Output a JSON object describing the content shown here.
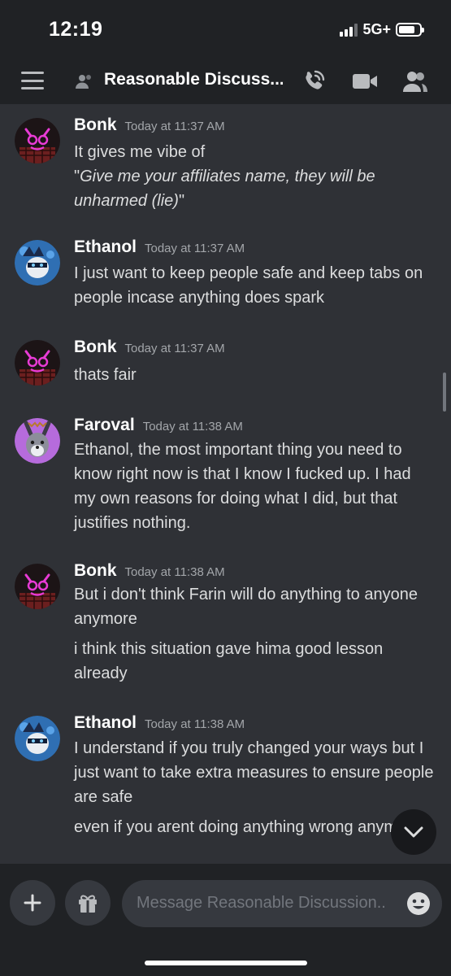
{
  "status": {
    "time": "12:19",
    "network": "5G+"
  },
  "header": {
    "channel_name": "Reasonable Discuss..."
  },
  "messages": [
    {
      "author": "Bonk",
      "timestamp": "Today at 11:37 AM",
      "avatar": "bonk-avatar",
      "lines": [
        "It gives me vibe of"
      ],
      "italic_parts": {
        "open": "\"",
        "emph": "Give me your affiliates name, they will be unharmed (lie)",
        "close": "\""
      }
    },
    {
      "author": "Ethanol",
      "timestamp": "Today at 11:37 AM",
      "avatar": "ethanol-avatar",
      "lines": [
        "I just want to keep people safe and keep tabs on people incase anything does spark"
      ]
    },
    {
      "author": "Bonk",
      "timestamp": "Today at 11:37 AM",
      "avatar": "bonk-avatar",
      "lines": [
        "thats fair"
      ]
    },
    {
      "author": "Faroval",
      "timestamp": "Today at 11:38 AM",
      "avatar": "faroval-avatar",
      "lines": [
        "Ethanol, the most important thing you need to know right now is that I know I fucked up. I had my own reasons for doing what I did, but that justifies nothing."
      ]
    },
    {
      "author": "Bonk",
      "timestamp": "Today at 11:38 AM",
      "avatar": "bonk-avatar",
      "lines": [
        "But i don't think Farin will do anything to anyone anymore",
        "i think this situation gave hima  good lesson already"
      ]
    },
    {
      "author": "Ethanol",
      "timestamp": "Today at 11:38 AM",
      "avatar": "ethanol-avatar",
      "lines": [
        "I understand if you truly changed your ways but I just want to take extra measures to ensure people are safe",
        "even if you arent doing anything wrong anymore"
      ]
    }
  ],
  "composer": {
    "placeholder": "Message Reasonable Discussion.."
  },
  "colors": {
    "background": "#2f3136",
    "bar": "#202225",
    "name": "#ffffff",
    "text": "#dcddde",
    "muted": "#a3a6aa"
  }
}
